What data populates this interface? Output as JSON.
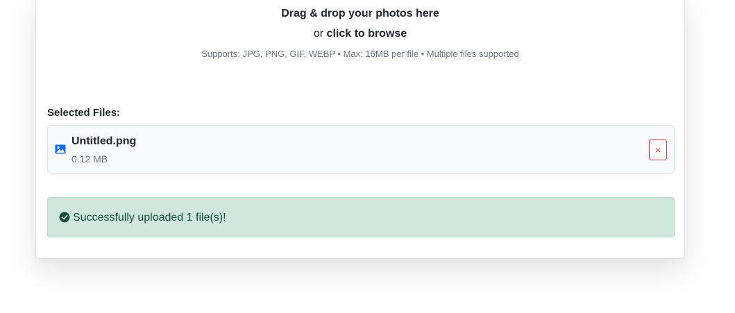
{
  "dropzone": {
    "title": "Drag & drop your photos here",
    "or_text": "or",
    "browse_text": "click to browse",
    "hint": "Supports: JPG, PNG, GIF, WEBP • Max: 16MB per file • Multiple files supported"
  },
  "selected_files": {
    "label": "Selected Files:",
    "items": [
      {
        "name": "Untitled.png",
        "size": "0.12 MB",
        "icon": "image-icon",
        "remove_label": "×"
      }
    ]
  },
  "alert": {
    "icon": "check-circle-icon",
    "text": "Successfully uploaded 1 file(s)!"
  },
  "colors": {
    "accent": "#0d6efd",
    "danger": "#dc3545",
    "success_bg": "#d1e7dd",
    "success_text": "#0f5132"
  }
}
